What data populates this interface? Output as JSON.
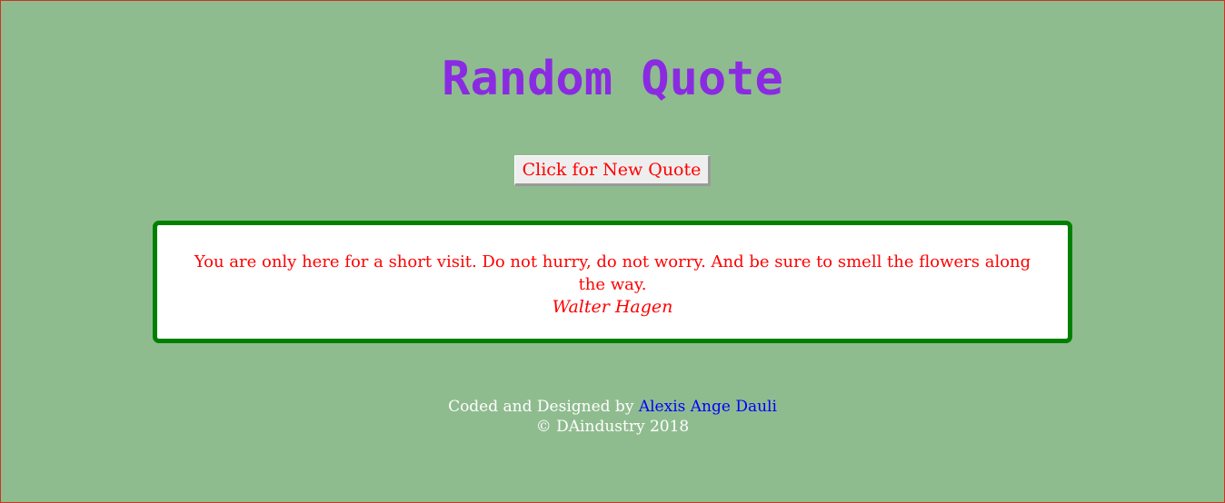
{
  "page": {
    "title": "Random Quote",
    "new_quote_button": "Click for New Quote",
    "quote": {
      "text": "You are only here for a short visit. Do not hurry, do not worry. And be sure to smell the flowers along the way.",
      "author": "Walter Hagen"
    },
    "footer": {
      "credit_prefix": "Coded and Designed by",
      "author_link": "Alexis Ange Dauli",
      "copyright": "© DAindustry 2018"
    }
  },
  "colors": {
    "background": "#8fbc8f",
    "title": "#8a2be2",
    "quote_text": "#ff0000",
    "quote_border": "#008000",
    "link": "#0000ff",
    "footer_text": "#ffffff"
  }
}
